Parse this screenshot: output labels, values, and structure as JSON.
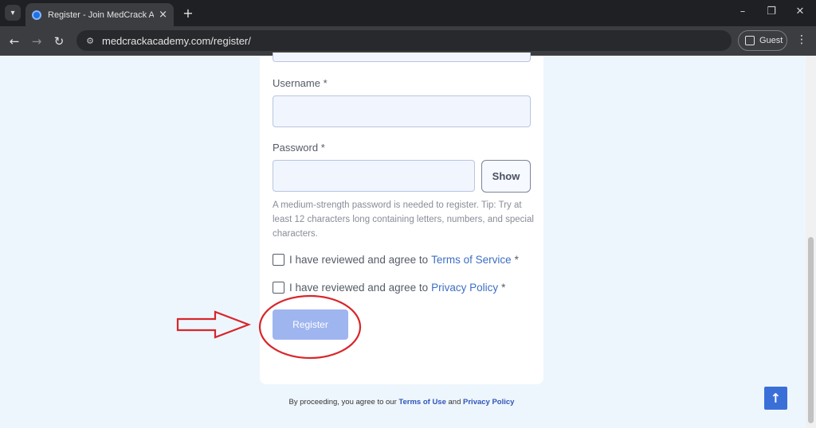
{
  "browser": {
    "tab_title": "Register - Join MedCrack Academy",
    "url": "medcrackacademy.com/register/",
    "profile_label": "Guest",
    "icons": {
      "tab_menu": "chevron-down",
      "tab_close": "×",
      "new_tab": "+",
      "minimize": "–",
      "restore": "❐",
      "close": "✕",
      "back": "←",
      "forward": "→",
      "reload": "↻",
      "menu": "⋮",
      "site_info": "⚙"
    }
  },
  "form": {
    "username_label": "Username *",
    "password_label": "Password *",
    "show_label": "Show",
    "password_hint": "A medium-strength password is needed to register. Tip: Try at least 12 characters long containing letters, numbers, and special characters.",
    "terms_prefix": "I have reviewed and agree to",
    "terms_link": "Terms of Service",
    "privacy_prefix": "I have reviewed and agree to",
    "privacy_link": "Privacy Policy",
    "required_mark": "*",
    "register_label": "Register"
  },
  "footer": {
    "prefix": "By proceeding, you agree to our",
    "terms_link": "Terms of Use",
    "conjunction": "and",
    "privacy_link": "Privacy Policy"
  },
  "scroll_top_icon": "↑",
  "colors": {
    "page_bg": "#eef6fd",
    "link": "#3d6fc4",
    "register_button": "#9fb5ef",
    "annotation": "#d8262b",
    "scroll_top_button": "#3b6fd8"
  }
}
